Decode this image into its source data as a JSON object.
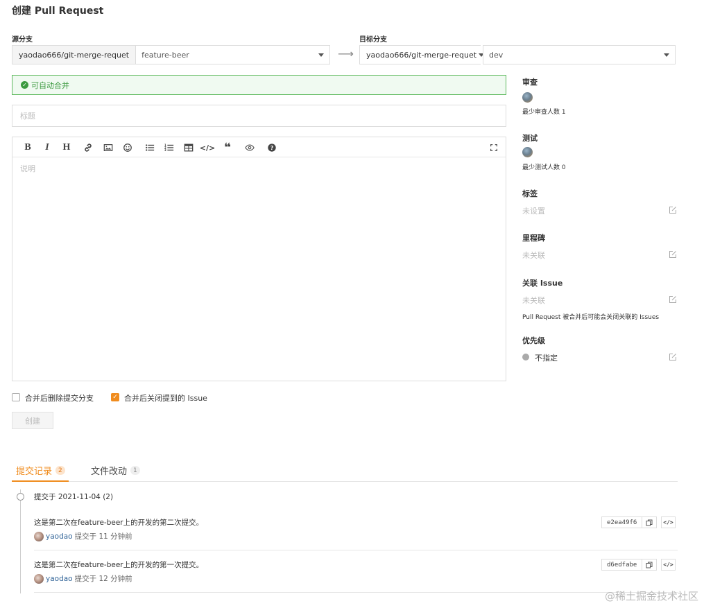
{
  "page": {
    "title": "创建 Pull Request"
  },
  "source": {
    "label": "源分支",
    "repo": "yaodao666/git-merge-requet",
    "branch": "feature-beer"
  },
  "target": {
    "label": "目标分支",
    "repo": "yaodao666/git-merge-requet",
    "branch": "dev"
  },
  "merge_status": "可自动合并",
  "form": {
    "title_placeholder": "标题",
    "description_placeholder": "说明"
  },
  "toolbar": {
    "bold": "B",
    "italic": "I",
    "heading": "H",
    "code": "</>",
    "quote": "❝"
  },
  "sidebar": {
    "review": {
      "label": "审查",
      "note": "最少审查人数 1"
    },
    "test": {
      "label": "测试",
      "note": "最少测试人数 0"
    },
    "tags": {
      "label": "标签",
      "value": "未设置"
    },
    "milestone": {
      "label": "里程碑",
      "value": "未关联"
    },
    "issue": {
      "label": "关联 Issue",
      "value": "未关联",
      "note": "Pull Request 被合并后可能会关闭关联的 Issues"
    },
    "priority": {
      "label": "优先级",
      "value": "不指定"
    }
  },
  "options": {
    "delete_branch": {
      "label": "合并后删除提交分支",
      "checked": false
    },
    "close_issue": {
      "label": "合并后关闭提到的 Issue",
      "checked": true
    }
  },
  "create_button": "创建",
  "tabs": [
    {
      "label": "提交记录",
      "count": "2",
      "active": true
    },
    {
      "label": "文件改动",
      "count": "1",
      "active": false
    }
  ],
  "commit_group": {
    "header": "提交于 2021-11-04  (2)"
  },
  "commits": [
    {
      "message": "这是第二次在feature-beer上的开发的第二次提交。",
      "author": "yaodao",
      "time": "提交于 11 分钟前",
      "sha": "e2ea49f6",
      "code_label": "</>"
    },
    {
      "message": "这是第二次在feature-beer上的开发的第一次提交。",
      "author": "yaodao",
      "time": "提交于 12 分钟前",
      "sha": "d6edfabe",
      "code_label": "</>"
    }
  ],
  "watermark": "@稀土掘金技术社区",
  "colors": {
    "accent": "#f08c1e",
    "success": "#3c9a40",
    "link": "#35679a"
  }
}
